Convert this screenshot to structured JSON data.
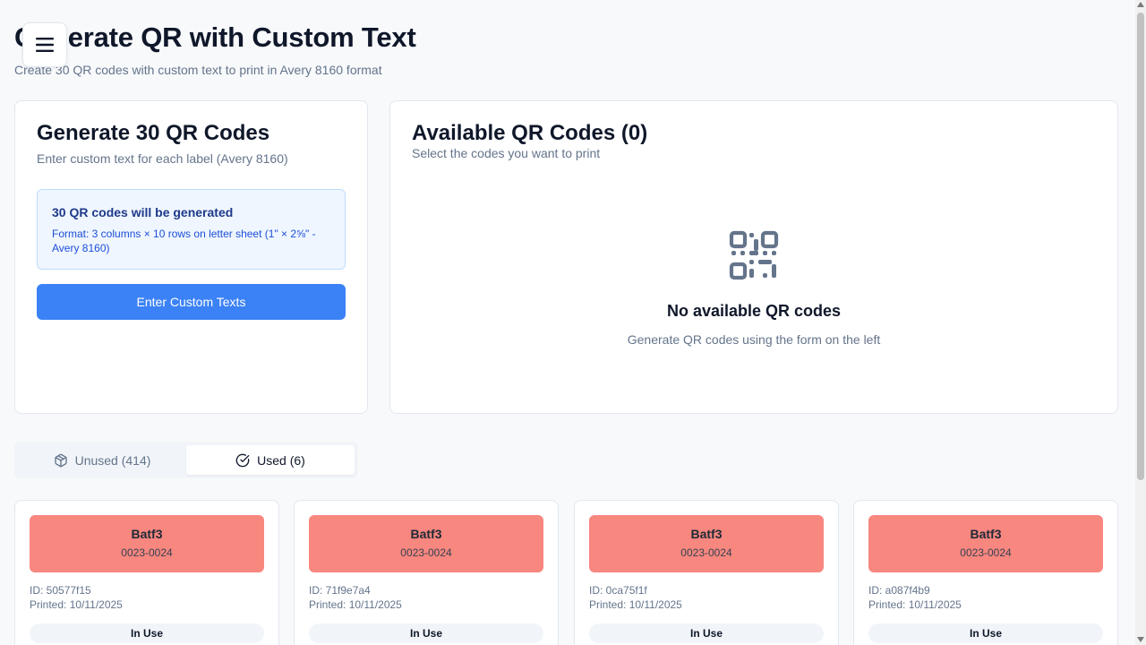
{
  "header": {
    "title": "Generate QR with Custom Text",
    "subtitle": "Create 30 QR codes with custom text to print in Avery 8160 format",
    "menu_icon": "hamburger-menu-icon"
  },
  "generator": {
    "title": "Generate 30 QR Codes",
    "subtitle": "Enter custom text for each label (Avery 8160)",
    "info_title": "30 QR codes will be generated",
    "info_text": "Format: 3 columns × 10 rows on letter sheet (1\" × 2⅝\" - Avery 8160)",
    "button_label": "Enter Custom Texts"
  },
  "available": {
    "title": "Available QR Codes (0)",
    "subtitle": "Select the codes you want to print",
    "empty_icon": "qr-code-icon",
    "empty_title": "No available QR codes",
    "empty_subtitle": "Generate QR codes using the form on the left"
  },
  "tabs": [
    {
      "label": "Unused (414)",
      "icon": "package-icon",
      "active": false
    },
    {
      "label": "Used (6)",
      "icon": "check-circle-icon",
      "active": true
    }
  ],
  "codes": [
    {
      "name": "Batf3",
      "number": "0023-0024",
      "id": "ID: 50577f15",
      "printed": "Printed: 10/11/2025",
      "status": "In Use"
    },
    {
      "name": "Batf3",
      "number": "0023-0024",
      "id": "ID: 71f9e7a4",
      "printed": "Printed: 10/11/2025",
      "status": "In Use"
    },
    {
      "name": "Batf3",
      "number": "0023-0024",
      "id": "ID: 0ca75f1f",
      "printed": "Printed: 10/11/2025",
      "status": "In Use"
    },
    {
      "name": "Batf3",
      "number": "0023-0024",
      "id": "ID: a087f4b9",
      "printed": "Printed: 10/11/2025",
      "status": "In Use"
    }
  ],
  "colors": {
    "primary": "#3b82f6",
    "used_label": "#f8877f",
    "info_bg": "#eff6ff"
  }
}
